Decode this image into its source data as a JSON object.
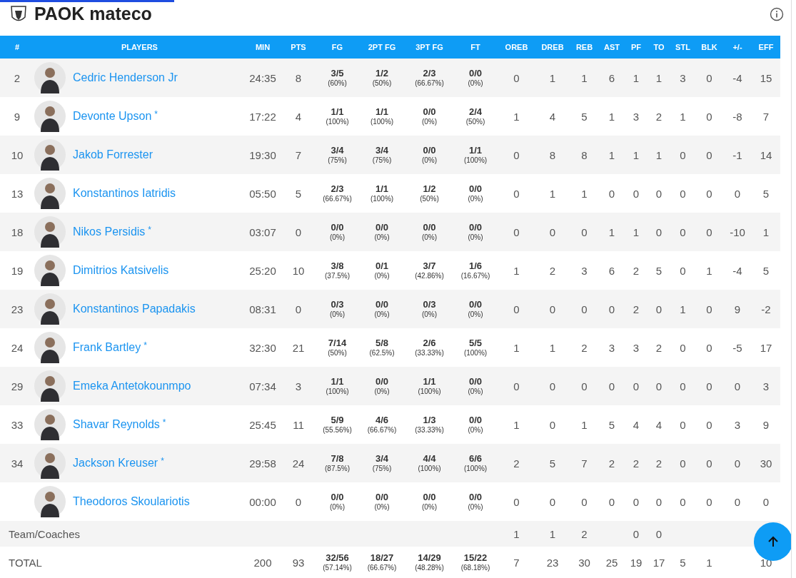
{
  "top_progress": {
    "level": 0.22
  },
  "team": {
    "name": "PAOK mateco"
  },
  "columns": [
    "#",
    "PLAYERS",
    "MIN",
    "PTS",
    "FG",
    "2PT FG",
    "3PT FG",
    "FT",
    "OREB",
    "DREB",
    "REB",
    "AST",
    "PF",
    "TO",
    "STL",
    "BLK",
    "+/-",
    "EFF"
  ],
  "players": [
    {
      "number": "2",
      "name": "Cedric Henderson Jr",
      "min": "24:35",
      "pts": "8",
      "shots": [
        [
          "3/5",
          "(60%)"
        ],
        [
          "1/2",
          "(50%)"
        ],
        [
          "2/3",
          "(66.67%)"
        ],
        [
          "0/0",
          "(0%)"
        ]
      ],
      "stats": {
        "oreb": "0",
        "dreb": "1",
        "reb": "1",
        "ast": "6",
        "pf": "1",
        "to": "1",
        "stl": "3",
        "blk": "0",
        "plus_minus": "-4",
        "eff": "15"
      }
    },
    {
      "number": "9",
      "name": "Devonte Upson",
      "starter_mark": "*",
      "min": "17:22",
      "pts": "4",
      "shots": [
        [
          "1/1",
          "(100%)"
        ],
        [
          "1/1",
          "(100%)"
        ],
        [
          "0/0",
          "(0%)"
        ],
        [
          "2/4",
          "(50%)"
        ]
      ],
      "stats": {
        "oreb": "1",
        "dreb": "4",
        "reb": "5",
        "ast": "1",
        "pf": "3",
        "to": "2",
        "stl": "1",
        "blk": "0",
        "plus_minus": "-8",
        "eff": "7"
      }
    },
    {
      "number": "10",
      "name": "Jakob Forrester",
      "min": "19:30",
      "pts": "7",
      "shots": [
        [
          "3/4",
          "(75%)"
        ],
        [
          "3/4",
          "(75%)"
        ],
        [
          "0/0",
          "(0%)"
        ],
        [
          "1/1",
          "(100%)"
        ]
      ],
      "stats": {
        "oreb": "0",
        "dreb": "8",
        "reb": "8",
        "ast": "1",
        "pf": "1",
        "to": "1",
        "stl": "0",
        "blk": "0",
        "plus_minus": "-1",
        "eff": "14"
      }
    },
    {
      "number": "13",
      "name": "Konstantinos Iatridis",
      "min": "05:50",
      "pts": "5",
      "shots": [
        [
          "2/3",
          "(66.67%)"
        ],
        [
          "1/1",
          "(100%)"
        ],
        [
          "1/2",
          "(50%)"
        ],
        [
          "0/0",
          "(0%)"
        ]
      ],
      "stats": {
        "oreb": "0",
        "dreb": "1",
        "reb": "1",
        "ast": "0",
        "pf": "0",
        "to": "0",
        "stl": "0",
        "blk": "0",
        "plus_minus": "0",
        "eff": "5"
      }
    },
    {
      "number": "18",
      "name": "Nikos Persidis",
      "starter_mark": "*",
      "min": "03:07",
      "pts": "0",
      "shots": [
        [
          "0/0",
          "(0%)"
        ],
        [
          "0/0",
          "(0%)"
        ],
        [
          "0/0",
          "(0%)"
        ],
        [
          "0/0",
          "(0%)"
        ]
      ],
      "stats": {
        "oreb": "0",
        "dreb": "0",
        "reb": "0",
        "ast": "1",
        "pf": "1",
        "to": "0",
        "stl": "0",
        "blk": "0",
        "plus_minus": "-10",
        "eff": "1"
      }
    },
    {
      "number": "19",
      "name": "Dimitrios Katsivelis",
      "min": "25:20",
      "pts": "10",
      "shots": [
        [
          "3/8",
          "(37.5%)"
        ],
        [
          "0/1",
          "(0%)"
        ],
        [
          "3/7",
          "(42.86%)"
        ],
        [
          "1/6",
          "(16.67%)"
        ]
      ],
      "stats": {
        "oreb": "1",
        "dreb": "2",
        "reb": "3",
        "ast": "6",
        "pf": "2",
        "to": "5",
        "stl": "0",
        "blk": "1",
        "plus_minus": "-4",
        "eff": "5"
      }
    },
    {
      "number": "23",
      "name": "Konstantinos Papadakis",
      "min": "08:31",
      "pts": "0",
      "shots": [
        [
          "0/3",
          "(0%)"
        ],
        [
          "0/0",
          "(0%)"
        ],
        [
          "0/3",
          "(0%)"
        ],
        [
          "0/0",
          "(0%)"
        ]
      ],
      "stats": {
        "oreb": "0",
        "dreb": "0",
        "reb": "0",
        "ast": "0",
        "pf": "2",
        "to": "0",
        "stl": "1",
        "blk": "0",
        "plus_minus": "9",
        "eff": "-2"
      }
    },
    {
      "number": "24",
      "name": "Frank Bartley",
      "starter_mark": "*",
      "min": "32:30",
      "pts": "21",
      "shots": [
        [
          "7/14",
          "(50%)"
        ],
        [
          "5/8",
          "(62.5%)"
        ],
        [
          "2/6",
          "(33.33%)"
        ],
        [
          "5/5",
          "(100%)"
        ]
      ],
      "stats": {
        "oreb": "1",
        "dreb": "1",
        "reb": "2",
        "ast": "3",
        "pf": "3",
        "to": "2",
        "stl": "0",
        "blk": "0",
        "plus_minus": "-5",
        "eff": "17"
      }
    },
    {
      "number": "29",
      "name": "Emeka Antetokounmpo",
      "min": "07:34",
      "pts": "3",
      "shots": [
        [
          "1/1",
          "(100%)"
        ],
        [
          "0/0",
          "(0%)"
        ],
        [
          "1/1",
          "(100%)"
        ],
        [
          "0/0",
          "(0%)"
        ]
      ],
      "stats": {
        "oreb": "0",
        "dreb": "0",
        "reb": "0",
        "ast": "0",
        "pf": "0",
        "to": "0",
        "stl": "0",
        "blk": "0",
        "plus_minus": "0",
        "eff": "3"
      }
    },
    {
      "number": "33",
      "name": "Shavar Reynolds",
      "starter_mark": "*",
      "min": "25:45",
      "pts": "11",
      "shots": [
        [
          "5/9",
          "(55.56%)"
        ],
        [
          "4/6",
          "(66.67%)"
        ],
        [
          "1/3",
          "(33.33%)"
        ],
        [
          "0/0",
          "(0%)"
        ]
      ],
      "stats": {
        "oreb": "1",
        "dreb": "0",
        "reb": "1",
        "ast": "5",
        "pf": "4",
        "to": "4",
        "stl": "0",
        "blk": "0",
        "plus_minus": "3",
        "eff": "9"
      }
    },
    {
      "number": "34",
      "name": "Jackson Kreuser",
      "starter_mark": "*",
      "min": "29:58",
      "pts": "24",
      "shots": [
        [
          "7/8",
          "(87.5%)"
        ],
        [
          "3/4",
          "(75%)"
        ],
        [
          "4/4",
          "(100%)"
        ],
        [
          "6/6",
          "(100%)"
        ]
      ],
      "stats": {
        "oreb": "2",
        "dreb": "5",
        "reb": "7",
        "ast": "2",
        "pf": "2",
        "to": "2",
        "stl": "0",
        "blk": "0",
        "plus_minus": "0",
        "eff": "30"
      }
    },
    {
      "name": "Theodoros Skoulariotis",
      "min": "00:00",
      "pts": "0",
      "shots": [
        [
          "0/0",
          "(0%)"
        ],
        [
          "0/0",
          "(0%)"
        ],
        [
          "0/0",
          "(0%)"
        ],
        [
          "0/0",
          "(0%)"
        ]
      ],
      "stats": {
        "oreb": "0",
        "dreb": "0",
        "reb": "0",
        "ast": "0",
        "pf": "0",
        "to": "0",
        "stl": "0",
        "blk": "0",
        "plus_minus": "0",
        "eff": "0"
      }
    }
  ],
  "team_row": {
    "label": "Team/Coaches",
    "stats": {
      "oreb": "1",
      "dreb": "1",
      "reb": "2",
      "pf": "0",
      "to": "0"
    }
  },
  "total_row": {
    "label": "TOTAL",
    "min": "200",
    "pts": "93",
    "shots": [
      [
        "32/56",
        "(57.14%)"
      ],
      [
        "18/27",
        "(66.67%)"
      ],
      [
        "14/29",
        "(48.28%)"
      ],
      [
        "15/22",
        "(68.18%)"
      ]
    ],
    "stats": {
      "oreb": "7",
      "dreb": "23",
      "reb": "30",
      "ast": "25",
      "pf": "19",
      "to": "17",
      "stl": "5",
      "blk": "1",
      "eff": "10"
    }
  }
}
